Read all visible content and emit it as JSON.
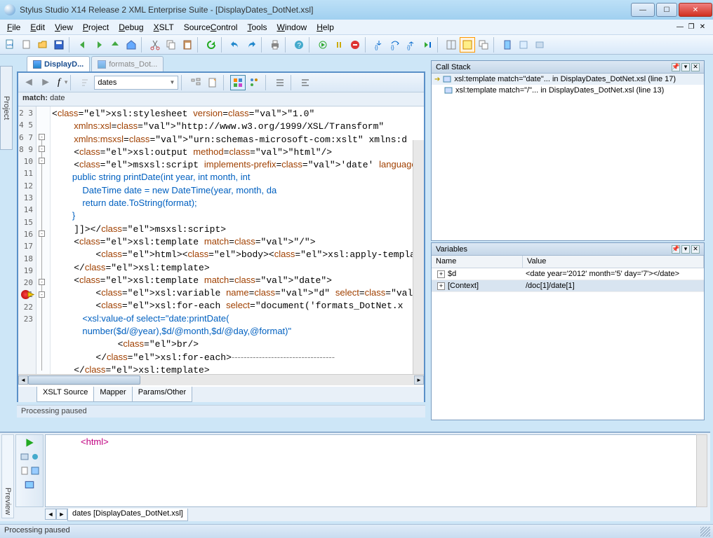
{
  "titlebar": {
    "text": "Stylus Studio X14 Release 2 XML Enterprise Suite - [DisplayDates_DotNet.xsl]"
  },
  "menubar": {
    "file": "File",
    "edit": "Edit",
    "view": "View",
    "project": "Project",
    "debug": "Debug",
    "xslt": "XSLT",
    "source": "SourceControl",
    "tools": "Tools",
    "window": "Window",
    "help": "Help"
  },
  "side_tab": "Project",
  "document_tabs": [
    {
      "label": "DisplayD...",
      "active": true
    },
    {
      "label": "formats_Dot...",
      "active": false
    }
  ],
  "editor_toolbar": {
    "function_label": "f",
    "dropdown_value": "dates"
  },
  "matchbar": {
    "label": "match:",
    "value": "date"
  },
  "code_lines": {
    "start": 2,
    "end": 23,
    "breakpoint_line": 17,
    "fold_minus_lines": [
      4,
      5,
      6,
      12,
      16,
      17
    ],
    "lines": [
      "<xsl:stylesheet version=\"1.0\"",
      "    xmlns:xsl=\"http://www.w3.org/1999/XSL/Transform\"",
      "    xmlns:msxsl=\"urn:schemas-microsoft-com:xslt\" xmlns:d",
      "    <xsl:output method=\"html\"/>",
      "    <msxsl:script implements-prefix='date' language='C#'",
      "        public string printDate(int year, int month, int",
      "            DateTime date = new DateTime(year, month, da",
      "            return date.ToString(format);",
      "        }",
      "    ]]></msxsl:script>",
      "    <xsl:template match=\"/\">",
      "        <html><body><xsl:apply-templates select=\"/doc/da",
      "    </xsl:template>",
      "    <xsl:template match=\"date\">",
      "        <xsl:variable name=\"d\" select=\".\"/>",
      "        <xsl:for-each select=\"document('formats_DotNet.x",
      "            <xsl:value-of select=\"date:printDate(",
      "            number($d/@year),$d/@month,$d/@day,@format)\"",
      "            <br/>",
      "        </xsl:for-each>----------------------------------",
      "    </xsl:template>",
      "</xsl:stylesheet>"
    ]
  },
  "source_tabs": [
    {
      "label": "XSLT Source",
      "active": true
    },
    {
      "label": "Mapper",
      "active": false
    },
    {
      "label": "Params/Other",
      "active": false
    }
  ],
  "editor_status": "Processing paused",
  "call_stack": {
    "title": "Call Stack",
    "rows": [
      {
        "active": true,
        "text": "xsl:template match=\"date\"... in DisplayDates_DotNet.xsl (line 17)"
      },
      {
        "active": false,
        "text": "xsl:template match=\"/\"... in DisplayDates_DotNet.xsl (line 13)"
      }
    ]
  },
  "variables": {
    "title": "Variables",
    "columns": {
      "name": "Name",
      "value": "Value"
    },
    "rows": [
      {
        "name": "$d",
        "value": "<date year='2012' month='5' day='7'></date>",
        "sel": false
      },
      {
        "name": "[Context]",
        "value": "/doc[1]/date[1]",
        "sel": true
      }
    ]
  },
  "preview": {
    "side_label": "Preview",
    "body": "<html>",
    "tab": "dates [DisplayDates_DotNet.xsl]"
  },
  "status": "Processing paused"
}
